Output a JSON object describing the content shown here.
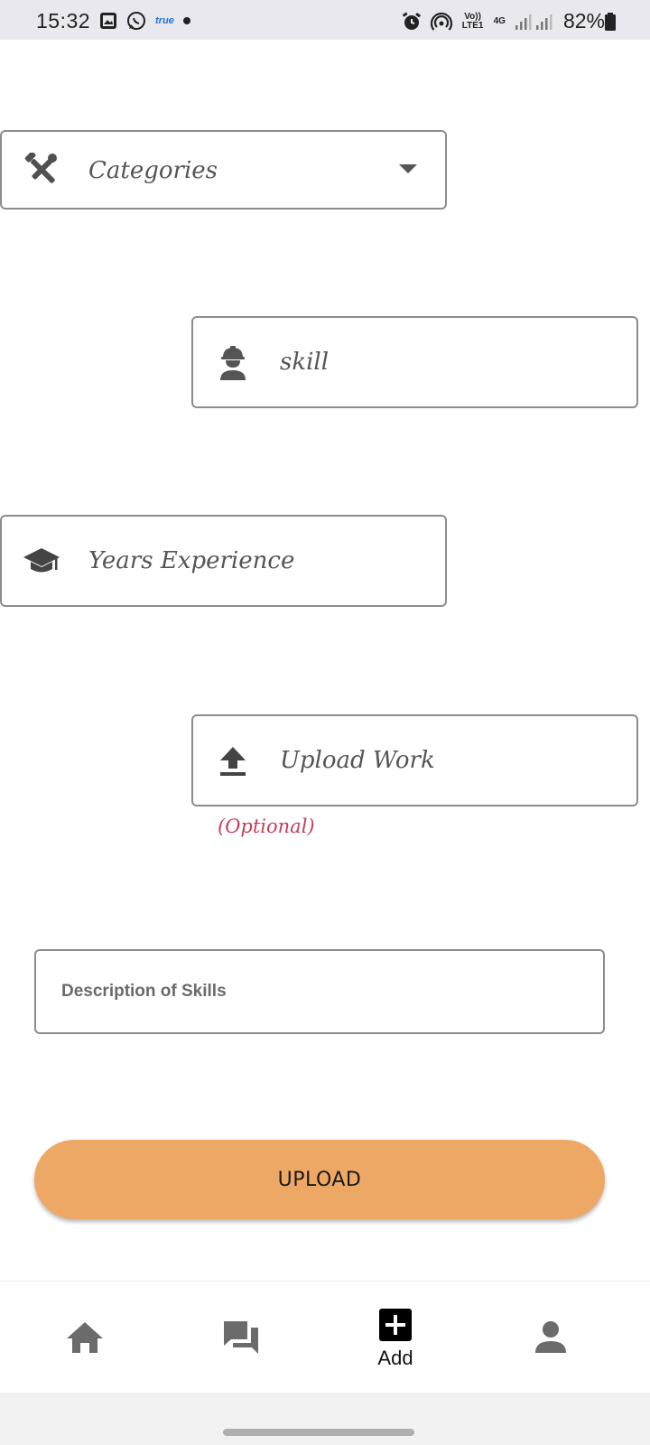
{
  "status_bar": {
    "time": "15:32",
    "carrier_logo": "true",
    "volte": "Vo)) LTE1",
    "network": "4G",
    "battery": "82%",
    "icons": [
      "gallery-icon",
      "whatsapp-icon",
      "alarm-icon",
      "hotspot-icon",
      "signal-icon",
      "battery-icon"
    ]
  },
  "form": {
    "categories": {
      "label": "Categories",
      "icon": "tools-icon"
    },
    "skill": {
      "label": "skill",
      "icon": "worker-icon"
    },
    "experience": {
      "label": "Years Experience",
      "icon": "graduation-cap-icon"
    },
    "upload_work": {
      "label": "Upload Work",
      "icon": "upload-icon",
      "note": "(Optional)"
    },
    "description": {
      "placeholder": "Description of Skills",
      "value": ""
    },
    "submit_label": "UPLOAD"
  },
  "bottom_nav": {
    "items": [
      {
        "id": "home",
        "icon": "home-icon",
        "label": ""
      },
      {
        "id": "chat",
        "icon": "chat-icon",
        "label": ""
      },
      {
        "id": "add",
        "icon": "add-box-icon",
        "label": "Add"
      },
      {
        "id": "profile",
        "icon": "person-icon",
        "label": ""
      }
    ]
  },
  "colors": {
    "accent_button": "#eea865",
    "optional_text": "#c43d5a",
    "icon_gray": "#6b6b6b"
  }
}
